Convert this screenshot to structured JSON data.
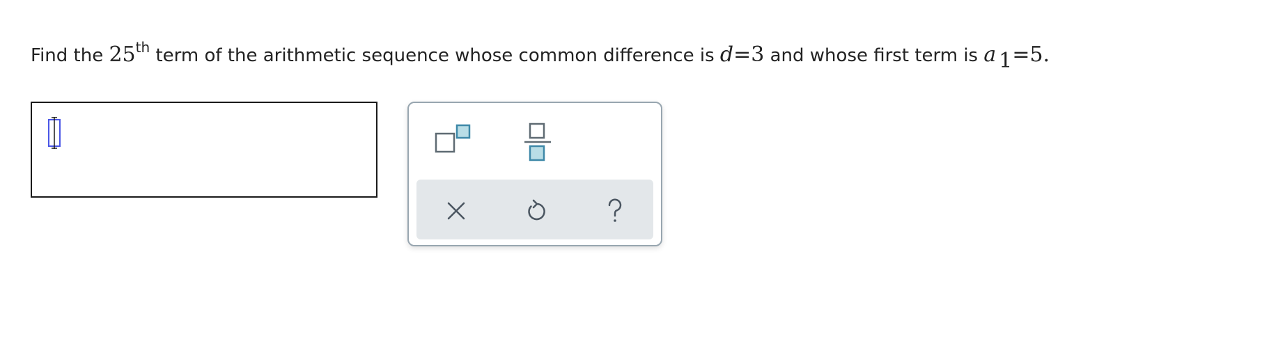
{
  "question": {
    "prefix": "Find the ",
    "term_number": "25",
    "term_suffix": "th",
    "middle": " term of the arithmetic sequence whose common difference is ",
    "d_var": "d",
    "d_eq": "=3",
    "and_text": " and whose first term is ",
    "a_var": "a",
    "a_sub": "1",
    "a_eq": "=5."
  },
  "answer": {
    "value": ""
  },
  "palette": {
    "buttons": [
      {
        "name": "exponent",
        "icon": "superscript-icon"
      },
      {
        "name": "fraction",
        "icon": "fraction-icon"
      },
      {
        "name": "clear",
        "icon": "close-icon"
      },
      {
        "name": "undo",
        "icon": "undo-icon"
      },
      {
        "name": "help",
        "icon": "question-mark-icon"
      }
    ]
  },
  "colors": {
    "palette_border": "#98a6b0",
    "palette_tray": "#e3e7ea",
    "icon_gray": "#5f6b73",
    "icon_blue_fill": "#b9dde6",
    "icon_blue_stroke": "#3e88a8",
    "cursor_blue": "#4a56e6"
  }
}
